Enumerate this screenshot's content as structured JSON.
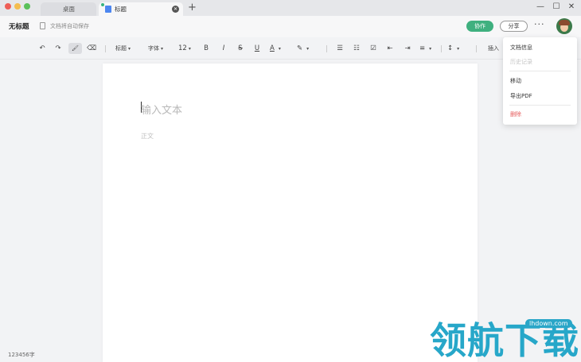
{
  "window": {
    "colors": {
      "close": "#ee5e57",
      "minimize": "#f4bd4f",
      "maximize": "#5ac05a"
    }
  },
  "tabs": [
    {
      "label": "桌面",
      "active": false
    },
    {
      "label": "标题",
      "active": true
    }
  ],
  "icons": {
    "new_tab": "+",
    "minimize": "—",
    "maximize": "☐",
    "close": "✕",
    "tab_close": "✕",
    "more": "···"
  },
  "header": {
    "title": "无标题",
    "autosave": "文档将自动保存",
    "collab_button": "协作",
    "share_button": "分享",
    "accent_color": "#3fb07f"
  },
  "toolbar": {
    "undo": "↶",
    "redo": "↷",
    "format_painter": "🖌",
    "eraser": "⌫",
    "heading": "标题",
    "font": "字体",
    "font_size": "12",
    "bold": "B",
    "italic": "I",
    "strike": "S",
    "underline": "U",
    "font_color": "A",
    "highlight": "✎",
    "ordered_list": "☰",
    "bullet_list": "☷",
    "checklist": "☑",
    "indent_decrease": "⇤",
    "indent_increase": "⇥",
    "align": "≡",
    "line_spacing": "↕",
    "insert": "插入",
    "caret": "▾"
  },
  "editor": {
    "placeholder": "输入文本",
    "body_style": "正文"
  },
  "status": {
    "word_count": "123456字"
  },
  "dropdown_menu": {
    "items": [
      {
        "label": "文档信息",
        "state": "normal"
      },
      {
        "label": "历史记录",
        "state": "disabled"
      },
      {
        "label": "移动",
        "state": "normal"
      },
      {
        "label": "导出PDF",
        "state": "normal"
      },
      {
        "label": "删除",
        "state": "danger"
      }
    ]
  },
  "watermark": {
    "text": "领航下载",
    "site": "lhdown.com"
  }
}
